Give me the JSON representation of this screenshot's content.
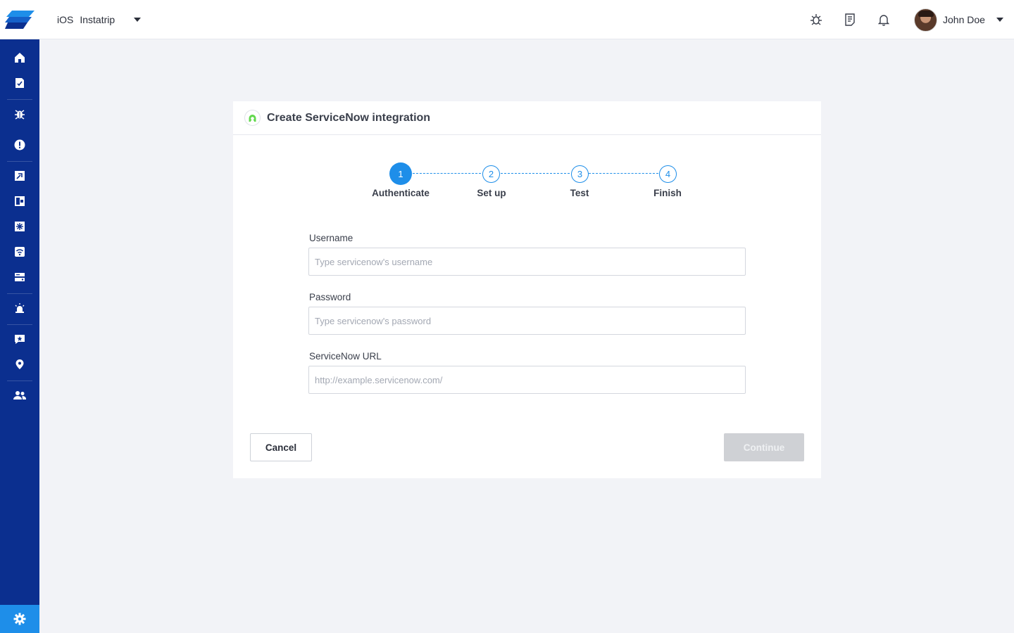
{
  "header": {
    "platform": "iOS",
    "app_name": "Instatrip",
    "user_name": "John Doe",
    "icons": [
      "bug-report-icon",
      "release-notes-icon",
      "notifications-bell-icon"
    ]
  },
  "sidebar": {
    "items": [
      {
        "icon": "home-icon"
      },
      {
        "icon": "reports-icon"
      },
      {
        "icon": "bug-icon"
      },
      {
        "icon": "crash-alert-icon"
      },
      {
        "icon": "launches-icon"
      },
      {
        "icon": "app-performance-icon"
      },
      {
        "icon": "network-icon"
      },
      {
        "icon": "wifi-icon"
      },
      {
        "icon": "storage-icon"
      },
      {
        "icon": "alerts-siren-icon"
      },
      {
        "icon": "feedback-icon"
      },
      {
        "icon": "location-pin-icon"
      },
      {
        "icon": "users-icon"
      }
    ],
    "settings_icon": "settings-gear-icon",
    "active_color": "#1e8ee9",
    "background": "#0b2f8f"
  },
  "card": {
    "title": "Create ServiceNow integration",
    "steps": [
      {
        "number": "1",
        "label": "Authenticate",
        "active": true
      },
      {
        "number": "2",
        "label": "Set up",
        "active": false
      },
      {
        "number": "3",
        "label": "Test",
        "active": false
      },
      {
        "number": "4",
        "label": "Finish",
        "active": false
      }
    ],
    "fields": {
      "username": {
        "label": "Username",
        "value": "",
        "placeholder": "Type servicenow's username"
      },
      "password": {
        "label": "Password",
        "value": "",
        "placeholder": "Type servicenow's password"
      },
      "url": {
        "label": "ServiceNow URL",
        "value": "",
        "placeholder": "http://example.servicenow.com/"
      }
    },
    "cancel_label": "Cancel",
    "continue_label": "Continue"
  }
}
